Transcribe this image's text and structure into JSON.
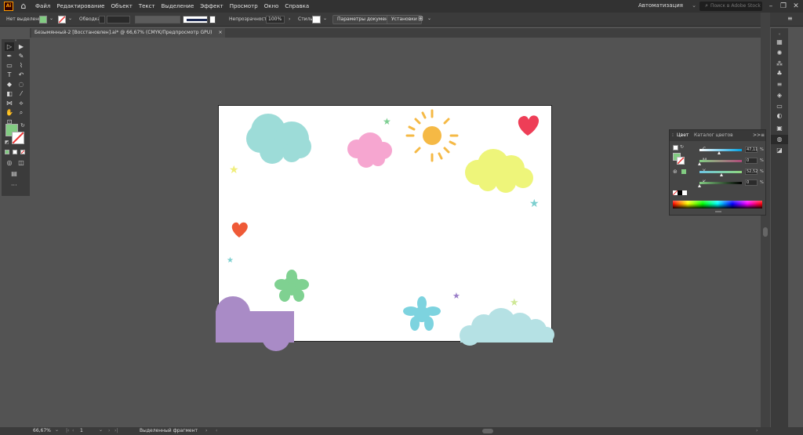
{
  "app": {
    "logo_text": "Ai"
  },
  "menu": [
    "Файл",
    "Редактирование",
    "Объект",
    "Текст",
    "Выделение",
    "Эффект",
    "Просмотр",
    "Окно",
    "Справка"
  ],
  "workspace": {
    "label": "Автоматизация",
    "search_placeholder": "Поиск в Adobe Stock"
  },
  "controlbar": {
    "selection_label": "Нет выделения",
    "stroke_label": "Обводка:",
    "opacity_label": "Непрозрачность:",
    "opacity_value": "100%",
    "style_label": "Стиль:",
    "doc_settings_button": "Параметры документа",
    "prefs_button": "Установки"
  },
  "document": {
    "tab_title": "Безымянный-2 [Восстановлен].ai* @ 66,67% (CMYK/Предпросмотр GPU)",
    "close_label": "×"
  },
  "color_panel": {
    "tab_color": "Цвет",
    "tab_guides": "Каталог цветов",
    "menu_glyph": ">>",
    "channels": [
      {
        "name": "C",
        "value": "47,11",
        "unit": "%",
        "fraction": 0.471
      },
      {
        "name": "M",
        "value": "0",
        "unit": "%",
        "fraction": 0.0
      },
      {
        "name": "Y",
        "value": "52,52",
        "unit": "%",
        "fraction": 0.525
      },
      {
        "name": "K",
        "value": "0",
        "unit": "%",
        "fraction": 0.0
      }
    ]
  },
  "status": {
    "zoom": "66,67%",
    "page": "1",
    "mode": "Выделенный фрагмент"
  },
  "colors": {
    "fill": "#82cc82",
    "cloud_teal": "#9ddcd8",
    "cloud_pink": "#f6a6d0",
    "cloud_yellow": "#eef57a",
    "sun": "#f5b945",
    "heart_red": "#ee3e57",
    "heart_orange": "#ef5a37",
    "flower_green": "#7fd191",
    "flower_blue": "#7dd3df",
    "cloud_purple": "#a98bc6",
    "cloud_lightblue": "#b5e1e4",
    "star_green": "#7fcf93",
    "star_yellow": "#f0ee7a",
    "star_teal": "#7ccfcf",
    "star_purple": "#9a7ec8"
  },
  "icons": [
    "home-icon",
    "search-icon",
    "selection-tool-icon",
    "pen-tool-icon",
    "type-tool-icon",
    "zoom-tool-icon",
    "hand-tool-icon"
  ]
}
